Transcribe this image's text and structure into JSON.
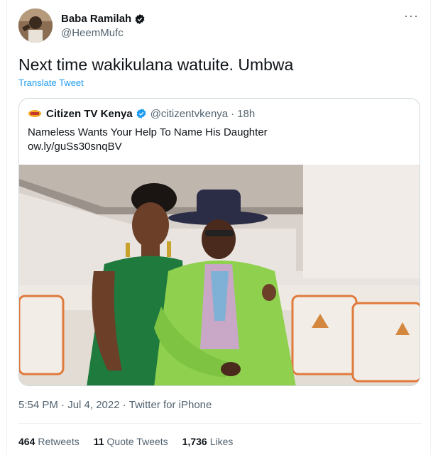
{
  "author": {
    "display_name": "Baba Ramilah",
    "handle": "@HeemMufc"
  },
  "tweet": {
    "text": "Next time wakikulana watuite. Umbwa",
    "translate_label": "Translate Tweet",
    "timestamp": "5:54 PM · Jul 4, 2022 · Twitter for iPhone"
  },
  "quoted": {
    "display_name": "Citizen TV Kenya",
    "handle": "@citizentvkenya",
    "separator": "·",
    "time": "18h",
    "text_line1": "Nameless Wants Your Help To Name His Daughter",
    "text_line2": "ow.ly/guSs30snqBV"
  },
  "stats": {
    "retweets_count": "464",
    "retweets_label": "Retweets",
    "quotes_count": "11",
    "quotes_label": "Quote Tweets",
    "likes_count": "1,736",
    "likes_label": "Likes"
  },
  "icons": {
    "more": "more-options-icon",
    "verified": "verified-badge-icon",
    "logo": "citizen-tv-logo"
  },
  "colors": {
    "accent": "#1d9bf0",
    "secondary_text": "#536471",
    "primary_text": "#0f1419",
    "border": "#cfd9de"
  }
}
